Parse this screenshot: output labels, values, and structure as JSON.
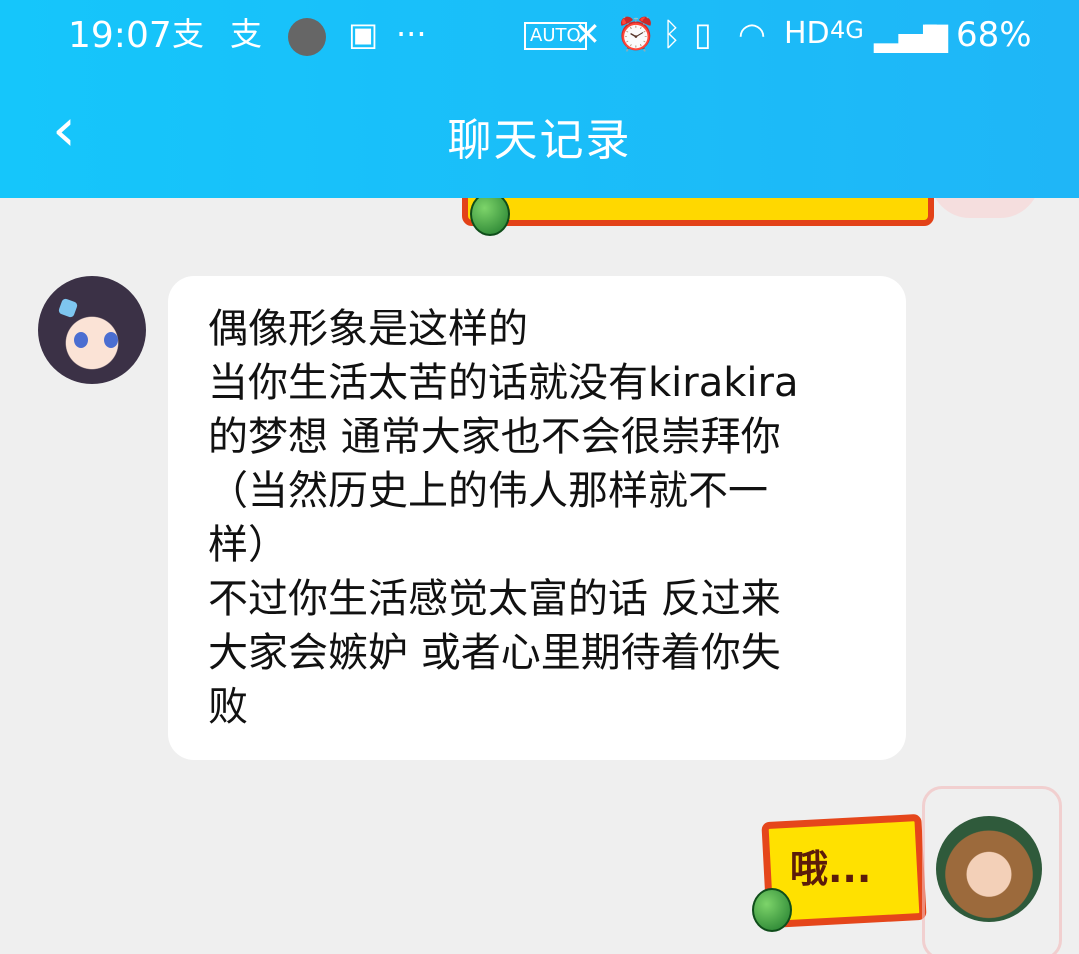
{
  "status_bar": {
    "time": "19:07",
    "left_icons": [
      "alipay-icon",
      "alipay-icon",
      "mail-icon",
      "image-icon",
      "more-dots-icon"
    ],
    "right_icons": [
      "auto-hz-icon",
      "x-icon",
      "alarm-icon",
      "bluetooth-icon",
      "vibrate-icon",
      "wifi-icon",
      "hd-icon",
      "4g-icon",
      "signal-icon",
      "battery-icon"
    ],
    "hd_label": "HD",
    "network_label": "4G",
    "battery_percent": "68%"
  },
  "header": {
    "title": "聊天记录",
    "back_icon": "chevron-left-icon",
    "colors": {
      "accent": "#1fb6f7"
    }
  },
  "messages": [
    {
      "side": "left",
      "avatar": "anime-girl-avatar",
      "lines": [
        "偶像形象是这样的",
        "当你生活太苦的话就没有kirakira",
        "的梦想 通常大家也不会很崇拜你",
        "（当然历史上的伟人那样就不一",
        "样）",
        "不过你生活感觉太富的话 反过来",
        "大家会嫉妒 或者心里期待着你失",
        "败"
      ]
    },
    {
      "side": "right",
      "avatar": "anime-boy-avatar",
      "sticker_text": "哦..."
    }
  ]
}
